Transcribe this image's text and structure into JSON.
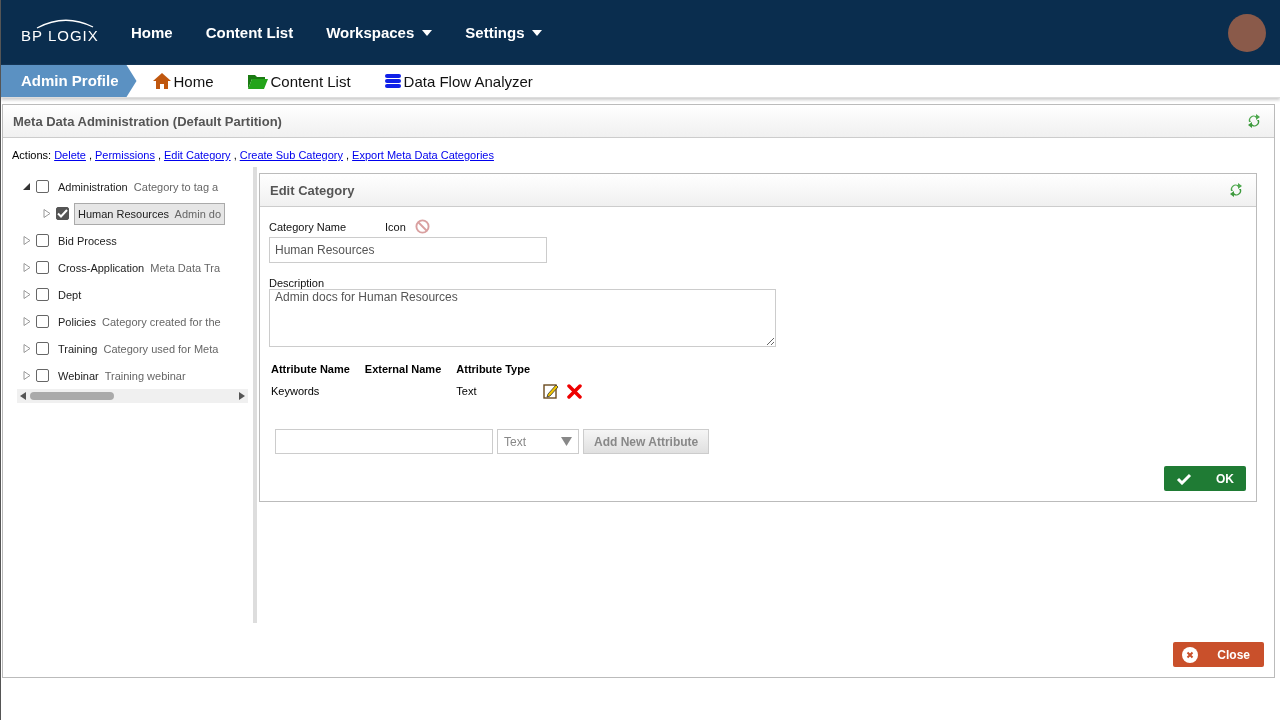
{
  "nav": {
    "logo": "BP LOGIX",
    "items": [
      {
        "label": "Home",
        "dropdown": false
      },
      {
        "label": "Content List",
        "dropdown": false
      },
      {
        "label": "Workspaces",
        "dropdown": true
      },
      {
        "label": "Settings",
        "dropdown": true
      }
    ]
  },
  "breadcrumb": {
    "current": "Admin Profile",
    "links": [
      {
        "label": "Home",
        "kind": "home"
      },
      {
        "label": "Content List",
        "kind": "folder"
      },
      {
        "label": "Data Flow Analyzer",
        "kind": "database"
      }
    ]
  },
  "panel": {
    "title": "Meta Data Administration (Default Partition)",
    "actions_label": "Actions:",
    "action_separator": ",",
    "actions": [
      "Delete",
      "Permissions",
      "Edit Category",
      "Create Sub Category",
      "Export Meta Data Categories"
    ],
    "tree": [
      {
        "name": "Administration",
        "description": "Category to tag a",
        "expanded": true,
        "checked": false,
        "selected": false,
        "children": [
          {
            "name": "Human Resources",
            "description": "Admin do",
            "expanded": false,
            "checked": true,
            "selected": true
          }
        ]
      },
      {
        "name": "Bid Process",
        "expanded": false,
        "checked": false,
        "selected": false
      },
      {
        "name": "Cross-Application",
        "description": "Meta Data Tra",
        "expanded": false,
        "checked": false,
        "selected": false
      },
      {
        "name": "Dept",
        "expanded": false,
        "checked": false,
        "selected": false
      },
      {
        "name": "Policies",
        "description": "Category created for the",
        "expanded": false,
        "checked": false,
        "selected": false
      },
      {
        "name": "Training",
        "description": "Category used for Meta",
        "expanded": false,
        "checked": false,
        "selected": false
      },
      {
        "name": "Webinar",
        "description": "Training webinar",
        "expanded": false,
        "checked": false,
        "selected": false
      }
    ],
    "editor": {
      "title": "Edit Category",
      "name_label": "Category Name",
      "icon_label": "Icon",
      "name_value": "Human Resources",
      "description_label": "Description",
      "description_value": "Admin docs for Human Resources",
      "columns": [
        "Attribute Name",
        "External Name",
        "Attribute Type"
      ],
      "attributes": [
        {
          "name": "Keywords",
          "type": "Text"
        }
      ],
      "new_type": "Text",
      "add_button": "Add New Attribute",
      "ok_button": "OK"
    },
    "close_button": "Close"
  }
}
